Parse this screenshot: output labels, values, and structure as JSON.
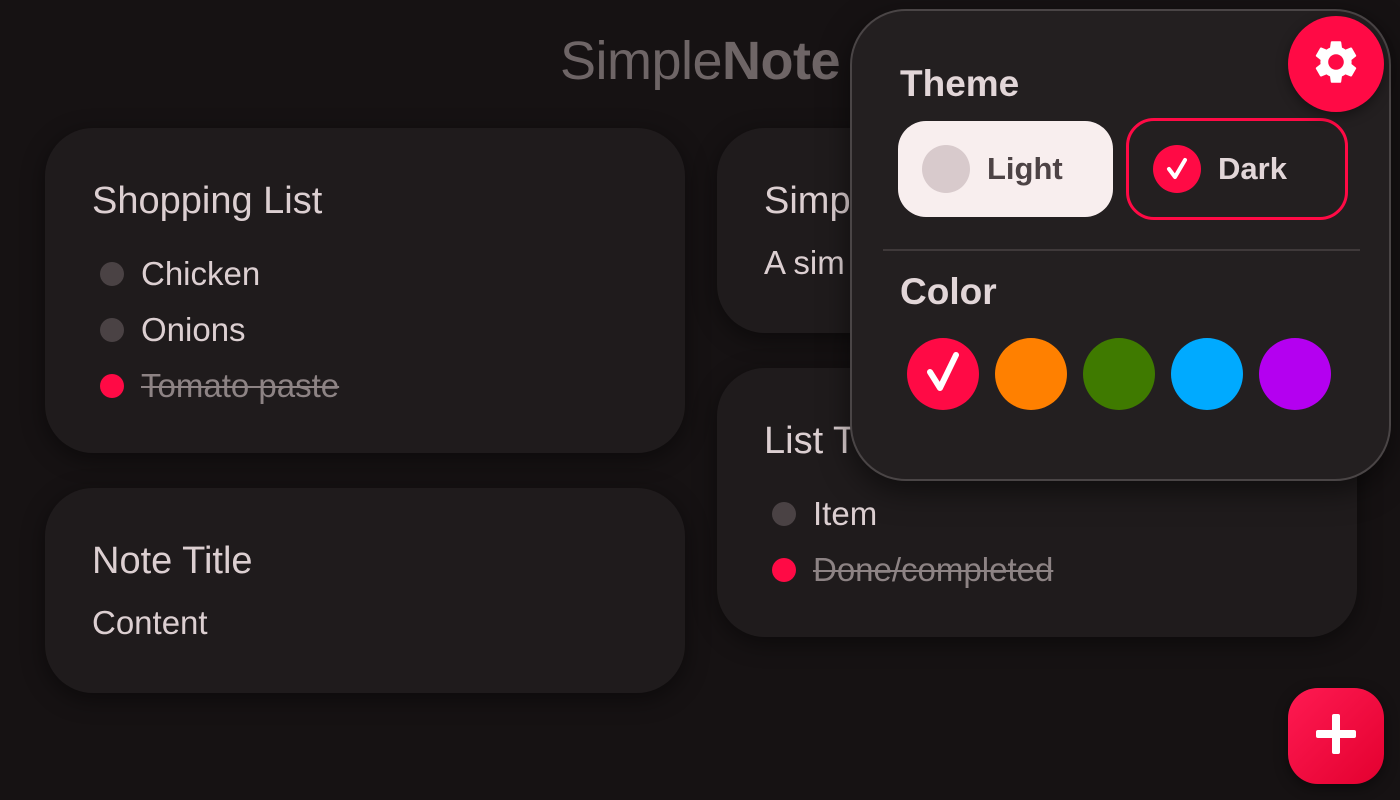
{
  "app": {
    "title_regular": "Simple",
    "title_bold": "Note"
  },
  "notes": {
    "shopping": {
      "title": "Shopping List",
      "items": [
        {
          "text": "Chicken",
          "done": false
        },
        {
          "text": "Onions",
          "done": false
        },
        {
          "text": "Tomato paste",
          "done": true
        }
      ]
    },
    "simple": {
      "title": "Simp",
      "content": "A sim"
    },
    "list": {
      "title": "List T",
      "items": [
        {
          "text": "Item",
          "done": false
        },
        {
          "text": "Done/completed",
          "done": true
        }
      ]
    },
    "note": {
      "title": "Note Title",
      "content": "Content"
    }
  },
  "settings": {
    "theme_label": "Theme",
    "theme_options": [
      {
        "label": "Light",
        "selected": false
      },
      {
        "label": "Dark",
        "selected": true
      }
    ],
    "color_label": "Color",
    "colors": [
      {
        "hex": "#ff0a45",
        "selected": true
      },
      {
        "hex": "#ff8000",
        "selected": false
      },
      {
        "hex": "#3f7a00",
        "selected": false
      },
      {
        "hex": "#00aaff",
        "selected": false
      },
      {
        "hex": "#b400f0",
        "selected": false
      }
    ]
  },
  "icons": {
    "settings": "gear-icon",
    "add": "plus-icon",
    "check": "check-icon"
  },
  "accent": "#ff0a45"
}
